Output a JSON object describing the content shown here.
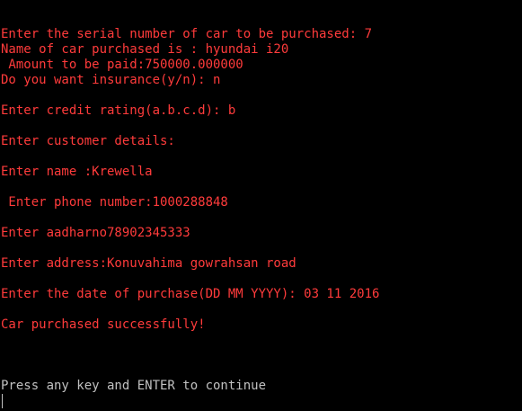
{
  "console": {
    "lines": [
      "Enter the serial number of car to be purchased: 7",
      "Name of car purchased is : hyundai i20",
      " Amount to be paid:750000.000000",
      "Do you want insurance(y/n): n",
      "Enter credit rating(a.b.c.d): b",
      "Enter customer details:",
      "Enter name :Krewella",
      " Enter phone number:1000288848",
      "Enter aadharno78902345333",
      "Enter address:Konuvahima gowrahsan road",
      "Enter the date of purchase(DD MM YYYY): 03 11 2016",
      "Car purchased successfully!"
    ],
    "prompt": "Press any key and ENTER to continue"
  },
  "colors": {
    "background": "#000000",
    "output_text": "#ff3b3b",
    "prompt_text": "#c0c0c0"
  }
}
